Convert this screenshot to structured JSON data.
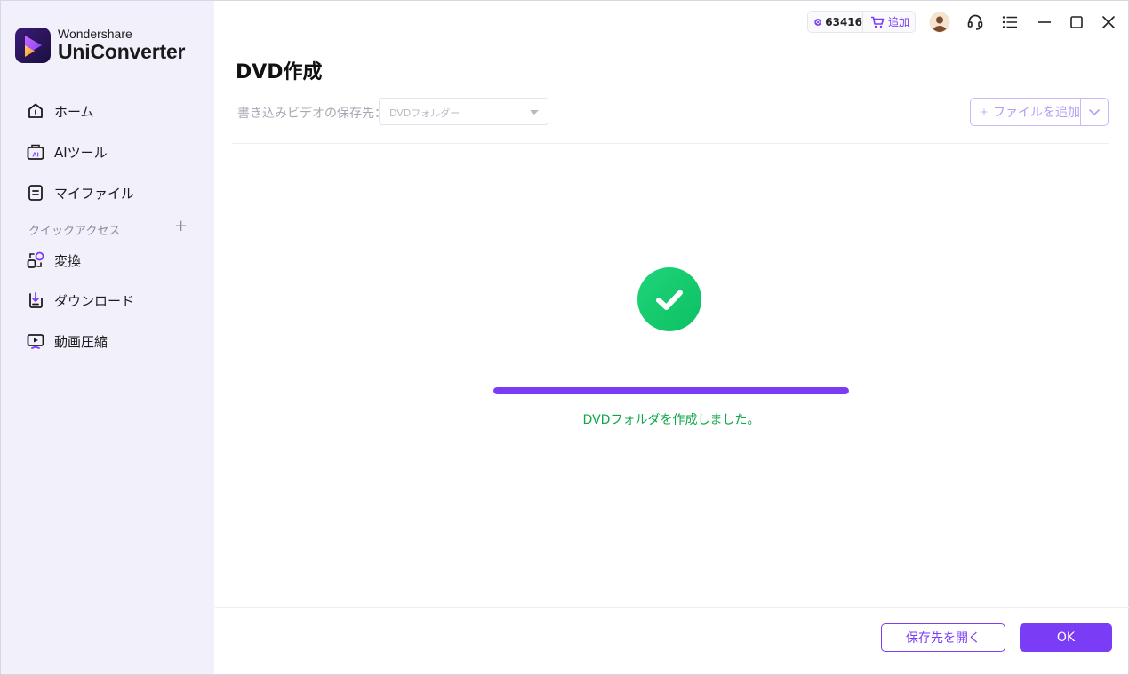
{
  "app": {
    "brand_top": "Wondershare",
    "brand_main": "UniConverter"
  },
  "colors": {
    "accent": "#7a3cf5",
    "sidebar_bg": "#f2f0fb",
    "success": "#0fa749"
  },
  "sidebar": {
    "items": [
      {
        "label": "ホーム",
        "icon": "home-icon"
      },
      {
        "label": "AIツール",
        "icon": "ai-tools-icon"
      },
      {
        "label": "マイファイル",
        "icon": "my-files-icon"
      }
    ],
    "quick_access_label": "クイックアクセス",
    "quick_items": [
      {
        "label": "変換",
        "icon": "convert-icon"
      },
      {
        "label": "ダウンロード",
        "icon": "download-icon"
      },
      {
        "label": "動画圧縮",
        "icon": "compress-icon"
      }
    ]
  },
  "titlebar": {
    "coins": "63416",
    "buy_label": "追加",
    "icons": [
      "avatar",
      "headset-icon",
      "menu-icon",
      "minimize-icon",
      "maximize-icon",
      "close-icon"
    ]
  },
  "main": {
    "title": "DVD作成",
    "destination_label": "書き込みビデオの保存先：",
    "destination_value": "DVDフォルダー",
    "add_file_label": "ファイルを追加",
    "progress_percent": 100,
    "status": "DVDフォルダを作成しました。",
    "open_folder_label": "保存先を開く",
    "ok_label": "OK"
  }
}
